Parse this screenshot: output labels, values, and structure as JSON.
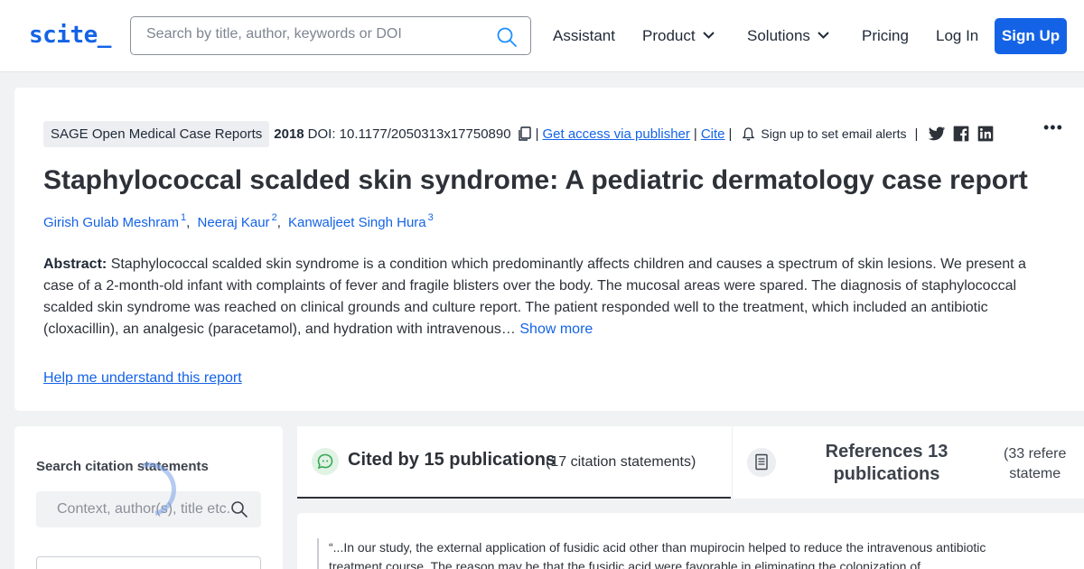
{
  "header": {
    "logo": "scite_",
    "search_placeholder": "Search by title, author, keywords or DOI",
    "nav": [
      "Assistant",
      "Product",
      "Solutions",
      "Pricing",
      "Log In"
    ],
    "signup": "Sign Up"
  },
  "article": {
    "journal": "SAGE Open Medical Case Reports",
    "year": "2018",
    "doi": "DOI: 10.1177/2050313x17750890",
    "access_link": "Get access via publisher",
    "cite_link": "Cite",
    "alerts": "Sign up to set email alerts",
    "title": "Staphylococcal scalded skin syndrome: A pediatric dermatology case report",
    "authors": [
      {
        "name": "Girish Gulab Meshram",
        "sup": "1"
      },
      {
        "name": "Neeraj Kaur",
        "sup": "2"
      },
      {
        "name": "Kanwaljeet Singh Hura",
        "sup": "3"
      }
    ],
    "abstract_label": "Abstract:",
    "abstract_text": "Staphylococcal scalded skin syndrome is a condition which predominantly affects children and causes a spectrum of skin lesions. We present a case of a 2-month-old infant with complaints of fever and fragile blisters over the body. The mucosal areas were spared. The diagnosis of staphylococcal scalded skin syndrome was reached on clinical grounds and culture report. The patient responded well to the treatment, which included an antibiotic (cloxacillin), an analgesic (paracetamol), and hydration with intravenous…",
    "show_more": "Show more",
    "help_link": "Help me understand this report"
  },
  "left_panel": {
    "title": "Search citation statements",
    "search_placeholder": "Context, author(s), title etc."
  },
  "tabs": {
    "cited_title": "Cited by 15 publications",
    "cited_sub": "(17 citation statements)",
    "refs_title": "References 13 publications",
    "refs_sub_line1": "(33 refere",
    "refs_sub_line2": "stateme"
  },
  "quote": {
    "text": "“...In our study, the external application of fusidic acid other than mupirocin helped to reduce the intravenous antibiotic treatment course. The reason may be that the fusidic acid were favorable in eliminating the colonization of"
  },
  "colors": {
    "accent": "#1463e6",
    "text": "#2d3138",
    "background": "#f1f2f4"
  }
}
